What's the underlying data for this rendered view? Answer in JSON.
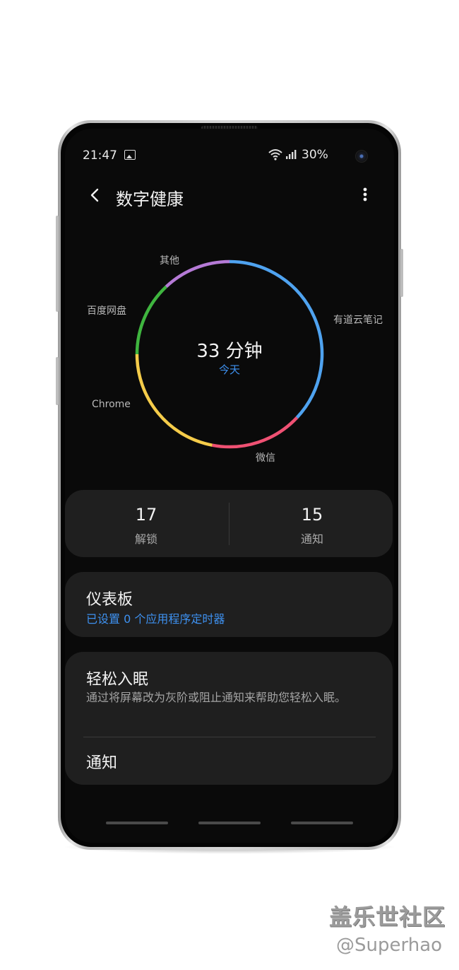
{
  "status_bar": {
    "time": "21:47",
    "battery": "30%",
    "icons": [
      "image-icon",
      "wifi-icon",
      "signal-icon",
      "camera-cutout"
    ]
  },
  "header": {
    "title": "数字健康",
    "back_icon": "chevron-left-icon",
    "menu_icon": "more-vert-icon"
  },
  "usage_chart": {
    "total_value": "33 分钟",
    "period": "今天",
    "segments": [
      {
        "app": "有道云笔记",
        "color": "#4fa3f0",
        "fraction": 0.37
      },
      {
        "app": "微信",
        "color": "#ef5173",
        "fraction": 0.16
      },
      {
        "app": "Chrome",
        "color": "#f5cc4a",
        "fraction": 0.22
      },
      {
        "app": "百度网盘",
        "color": "#3fb53f",
        "fraction": 0.13
      },
      {
        "app": "其他",
        "color": "#b57ad6",
        "fraction": 0.12
      }
    ]
  },
  "stats": {
    "unlocks_value": "17",
    "unlocks_label": "解锁",
    "notifications_value": "15",
    "notifications_label": "通知"
  },
  "dashboard": {
    "title": "仪表板",
    "subtitle": "已设置 0 个应用程序定时器"
  },
  "wind_down": {
    "title": "轻松入眠",
    "description": "通过将屏幕改为灰阶或阻止通知来帮助您轻松入眠。"
  },
  "notifications_item": {
    "title": "通知"
  },
  "watermark": {
    "line1": "盖乐世社区",
    "line2": "@Superhao"
  },
  "colors": {
    "accent": "#3e91f0",
    "card": "#1f1f1f",
    "screen": "#0a0a0a"
  }
}
